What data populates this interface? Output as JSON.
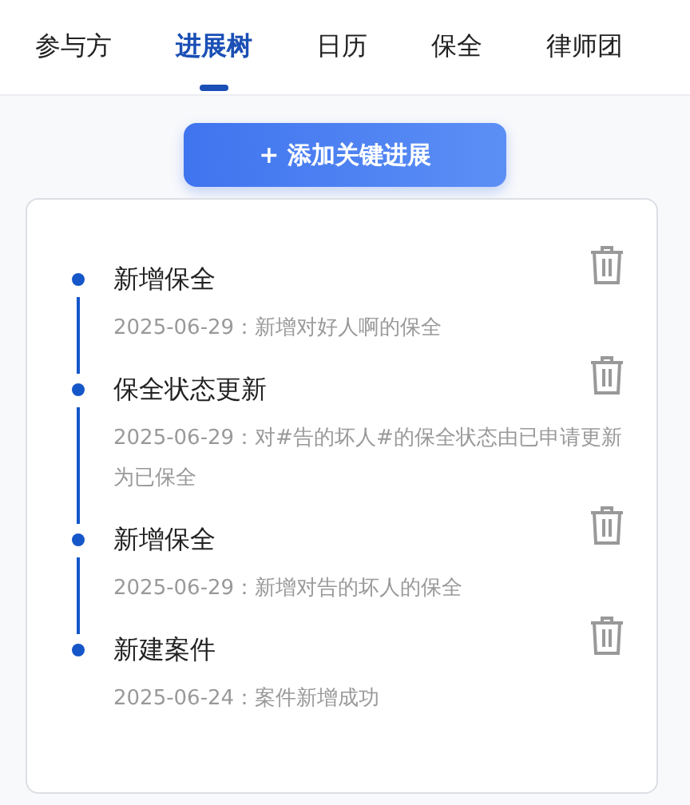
{
  "tabs": [
    {
      "label": "参与方",
      "selected": false
    },
    {
      "label": "进展树",
      "selected": true
    },
    {
      "label": "日历",
      "selected": false
    },
    {
      "label": "保全",
      "selected": false
    },
    {
      "label": "律师团",
      "selected": false
    }
  ],
  "add_button": "+ 添加关键进展",
  "timeline": [
    {
      "title": "新增保全",
      "description": "2025-06-29：新增对好人啊的保全"
    },
    {
      "title": "保全状态更新",
      "description": "2025-06-29：对#告的坏人#的保全状态由已申请更新为已保全"
    },
    {
      "title": "新增保全",
      "description": "2025-06-29：新增对告的坏人的保全"
    },
    {
      "title": "新建案件",
      "description": "2025-06-24：案件新增成功"
    }
  ]
}
